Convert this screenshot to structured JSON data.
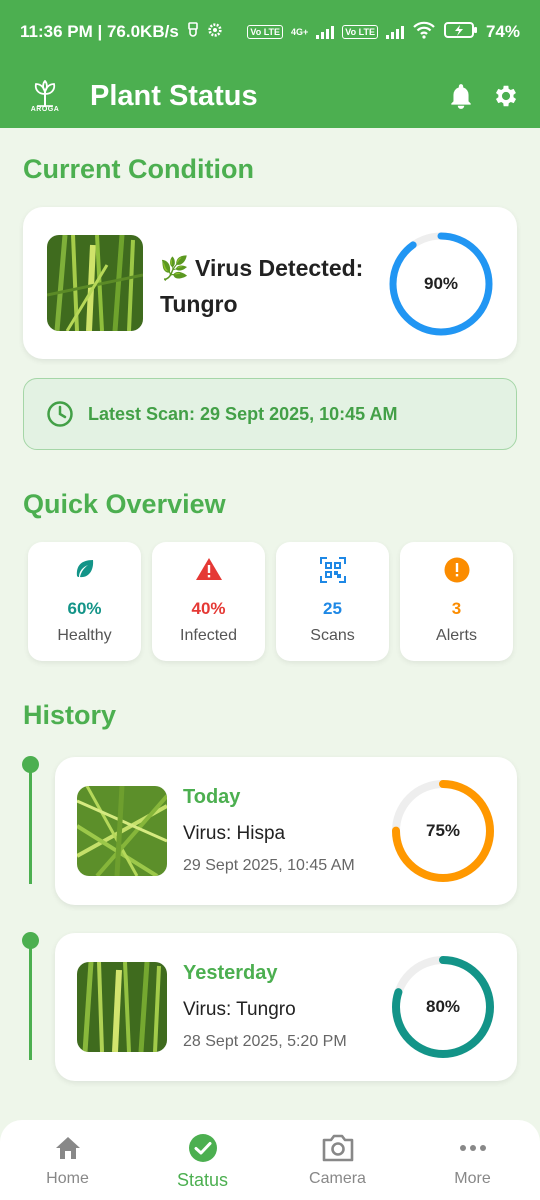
{
  "status_bar": {
    "time_speed": "11:36 PM | 76.0KB/s",
    "volte1": "Vo LTE",
    "net": "4G+",
    "volte2": "Vo LTE",
    "battery": "74%"
  },
  "app_bar": {
    "logo_text": "AROGA",
    "title": "Plant Status"
  },
  "current_condition": {
    "heading": "Current Condition",
    "emoji": "🌿",
    "status_line1": "Virus Detected:",
    "status_line2": "Tungro",
    "confidence": 90,
    "confidence_label": "90%",
    "ring_color": "#2196f3"
  },
  "latest_scan": {
    "text": "Latest Scan: 29 Sept 2025, 10:45 AM"
  },
  "quick_overview": {
    "heading": "Quick Overview",
    "items": [
      {
        "icon": "leaf-icon",
        "value": "60%",
        "label": "Healthy",
        "color": "#139488"
      },
      {
        "icon": "warning-icon",
        "value": "40%",
        "label": "Infected",
        "color": "#e53935"
      },
      {
        "icon": "qr-scan-icon",
        "value": "25",
        "label": "Scans",
        "color": "#1e88e5"
      },
      {
        "icon": "alert-circle-icon",
        "value": "3",
        "label": "Alerts",
        "color": "#fb8c00"
      }
    ]
  },
  "history": {
    "heading": "History",
    "items": [
      {
        "title": "Today",
        "virus": "Virus: Hispa",
        "time": "29 Sept 2025, 10:45 AM",
        "confidence": 75,
        "confidence_label": "75%",
        "ring_color": "#ff9800"
      },
      {
        "title": "Yesterday",
        "virus": "Virus: Tungro",
        "time": "28 Sept 2025, 5:20 PM",
        "confidence": 80,
        "confidence_label": "80%",
        "ring_color": "#139488"
      }
    ]
  },
  "bottom_nav": {
    "items": [
      {
        "icon": "home-icon",
        "label": "Home",
        "active": false
      },
      {
        "icon": "check-circle-icon",
        "label": "Status",
        "active": true
      },
      {
        "icon": "camera-icon",
        "label": "Camera",
        "active": false
      },
      {
        "icon": "more-icon",
        "label": "More",
        "active": false
      }
    ]
  },
  "colors": {
    "primary": "#4caf50",
    "background": "#eef6ea"
  }
}
